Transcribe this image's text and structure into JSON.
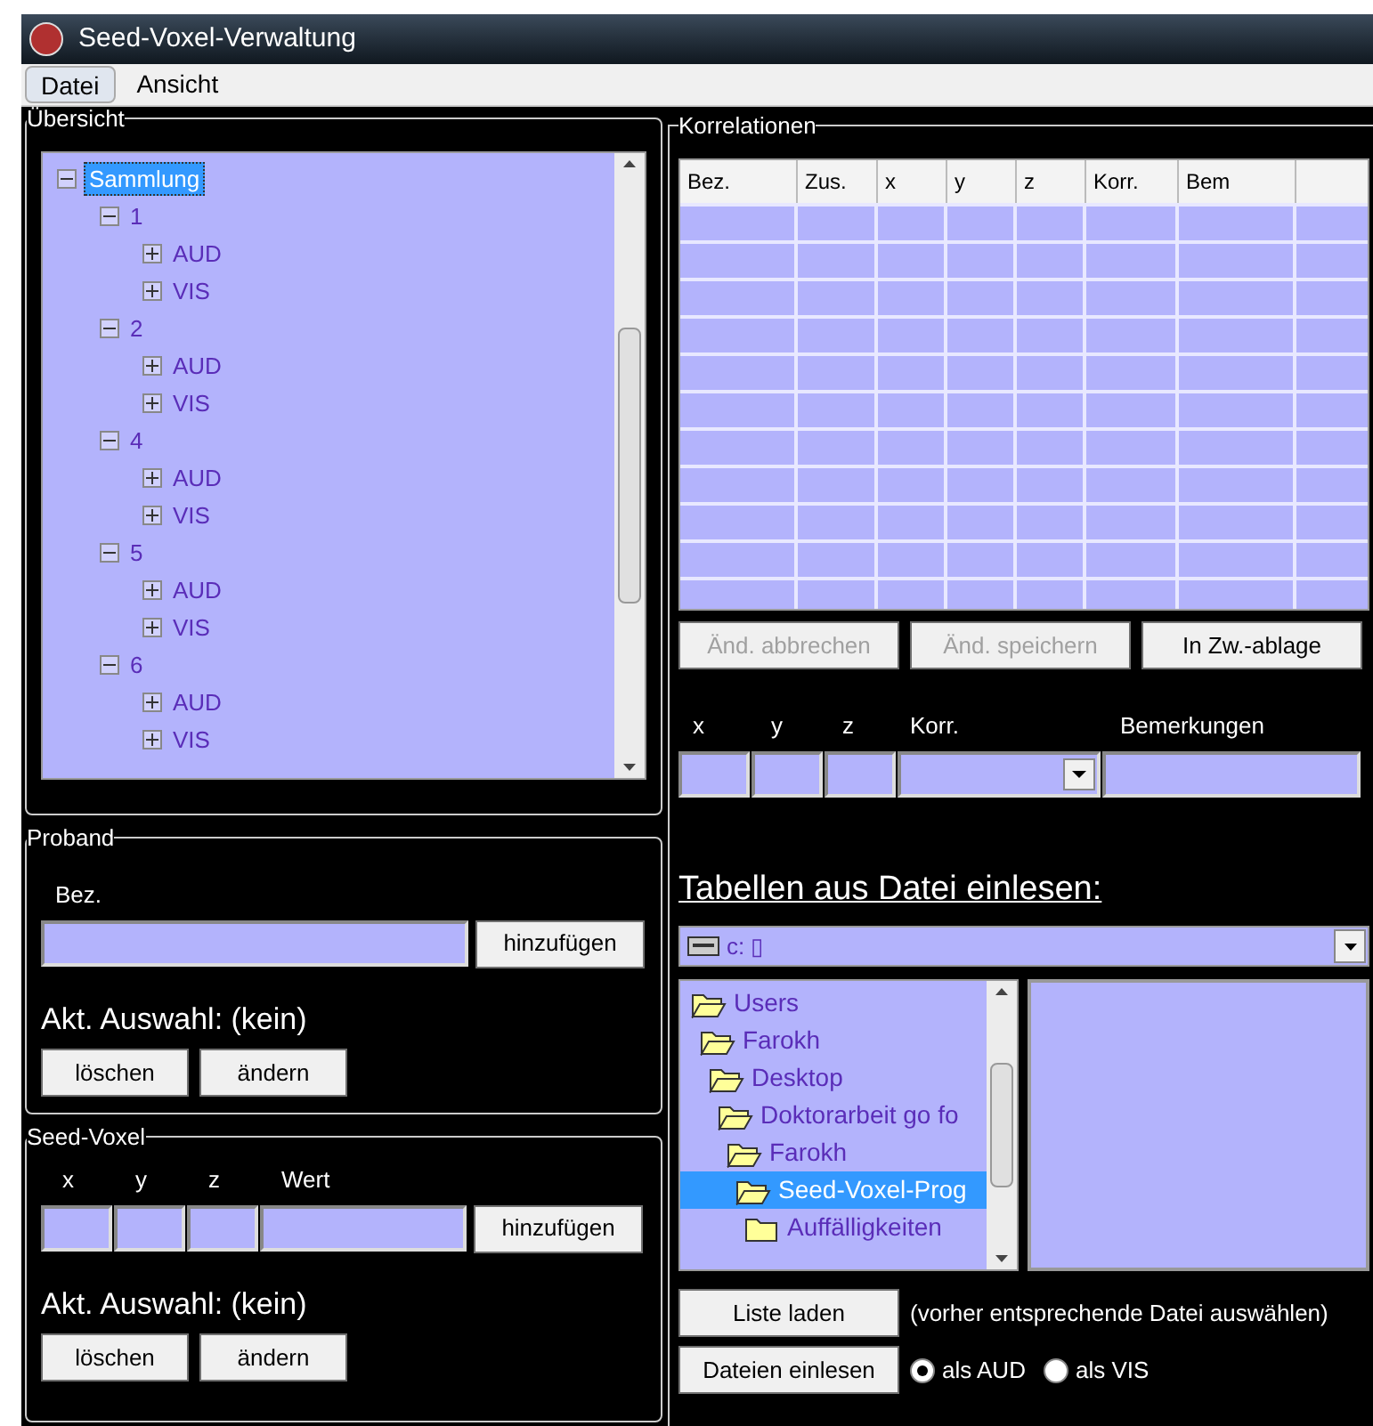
{
  "window": {
    "title": "Seed-Voxel-Verwaltung"
  },
  "menu": [
    {
      "label": "Datei",
      "selected": true
    },
    {
      "label": "Ansicht",
      "selected": false
    }
  ],
  "overview": {
    "title": "Übersicht",
    "tree": [
      {
        "label": "Sammlung",
        "selected": true,
        "expanded": true,
        "children": [
          {
            "label": "1",
            "selected": false,
            "expanded": true,
            "children": [
              {
                "label": "AUD",
                "selected": false,
                "expanded": false
              },
              {
                "label": "VIS",
                "selected": false,
                "expanded": false
              }
            ]
          },
          {
            "label": "2",
            "selected": false,
            "expanded": true,
            "children": [
              {
                "label": "AUD",
                "selected": false,
                "expanded": false
              },
              {
                "label": "VIS",
                "selected": false,
                "expanded": false
              }
            ]
          },
          {
            "label": "4",
            "selected": false,
            "expanded": true,
            "children": [
              {
                "label": "AUD",
                "selected": false,
                "expanded": false
              },
              {
                "label": "VIS",
                "selected": false,
                "expanded": false
              }
            ]
          },
          {
            "label": "5",
            "selected": false,
            "expanded": true,
            "children": [
              {
                "label": "AUD",
                "selected": false,
                "expanded": false
              },
              {
                "label": "VIS",
                "selected": false,
                "expanded": false
              }
            ]
          },
          {
            "label": "6",
            "selected": false,
            "expanded": true,
            "children": [
              {
                "label": "AUD",
                "selected": false,
                "expanded": false
              },
              {
                "label": "VIS",
                "selected": false,
                "expanded": false
              }
            ]
          }
        ]
      }
    ]
  },
  "proband": {
    "title": "Proband",
    "field_label": "Bez.",
    "add_button": "hinzufügen",
    "selection": "Akt. Auswahl: (kein)",
    "buttons": [
      "löschen",
      "ändern"
    ]
  },
  "seed_voxel": {
    "title": "Seed-Voxel",
    "field_labels": [
      "x",
      "y",
      "z",
      "Wert"
    ],
    "add_button": "hinzufügen",
    "selection": "Akt. Auswahl: (kein)",
    "buttons": [
      "löschen",
      "ändern"
    ]
  },
  "correlations": {
    "title": "Korrelationen",
    "table": {
      "columns": [
        "Bez.",
        "Zus.",
        "x",
        "y",
        "z",
        "Korr.",
        "Bem"
      ]
    },
    "buttons": [
      {
        "label": "Änd. abbrechen",
        "disabled": true
      },
      {
        "label": "Änd. speichern",
        "disabled": true
      },
      {
        "label": "In Zw.-ablage",
        "disabled": false
      }
    ],
    "field_labels": [
      "x",
      "y",
      "z",
      "Korr.",
      "Bemerkungen"
    ]
  },
  "import": {
    "heading": "Tabellen aus Datei einlesen:",
    "drive": "c: ▯",
    "folders": [
      {
        "label": "Users",
        "open": true,
        "selected": false,
        "children": [
          {
            "label": "Farokh",
            "open": true,
            "selected": false,
            "children": [
              {
                "label": "Desktop",
                "open": true,
                "selected": false,
                "children": [
                  {
                    "label": "Doktorarbeit go fo",
                    "open": true,
                    "selected": false,
                    "children": [
                      {
                        "label": "Farokh",
                        "open": true,
                        "selected": false,
                        "children": [
                          {
                            "label": "Seed-Voxel-Prog",
                            "open": true,
                            "selected": true,
                            "children": [
                              {
                                "label": "Auffälligkeiten",
                                "open": false,
                                "selected": false
                              }
                            ]
                          }
                        ]
                      }
                    ]
                  }
                ]
              }
            ]
          }
        ]
      }
    ],
    "load_button": "Liste laden",
    "hint": "(vorher entsprechende Datei auswählen)",
    "read_button": "Dateien einlesen",
    "modes": [
      {
        "label": "als AUD",
        "selected": true
      },
      {
        "label": "als VIS",
        "selected": false
      }
    ]
  }
}
